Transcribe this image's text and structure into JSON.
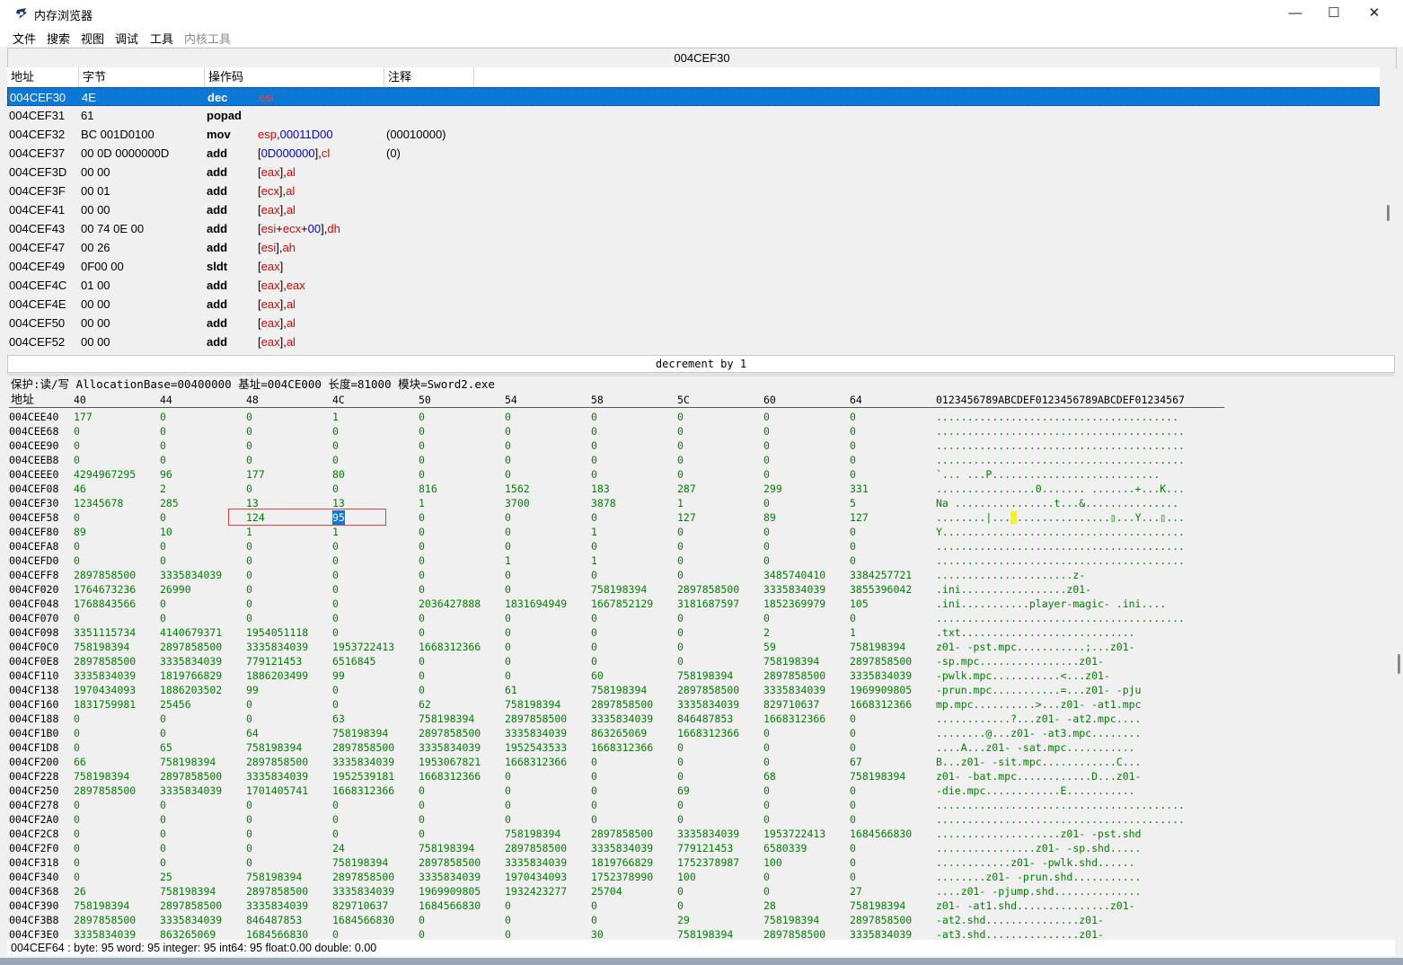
{
  "window": {
    "title": "内存浏览器",
    "minimize": "—",
    "maximize": "☐",
    "close": "✕"
  },
  "menu": [
    {
      "label": "文件",
      "enabled": true
    },
    {
      "label": "搜索",
      "enabled": true
    },
    {
      "label": "视图",
      "enabled": true
    },
    {
      "label": "调试",
      "enabled": true
    },
    {
      "label": "工具",
      "enabled": true
    },
    {
      "label": "内核工具",
      "enabled": false
    }
  ],
  "address_bar": "004CEF30",
  "disasm": {
    "columns": [
      "地址",
      "字节",
      "操作码",
      "注释"
    ],
    "rows": [
      {
        "addr": "004CEF30",
        "bytes": "4E",
        "op": "dec",
        "args": [
          {
            "t": "esi",
            "c": "r"
          }
        ],
        "comment": "",
        "selected": true
      },
      {
        "addr": "004CEF31",
        "bytes": "61",
        "op": "popad",
        "args": [],
        "comment": ""
      },
      {
        "addr": "004CEF32",
        "bytes": "BC 001D0100",
        "op": "mov",
        "args": [
          {
            "t": "esp",
            "c": "r"
          },
          {
            "t": ",",
            "c": "k"
          },
          {
            "t": "00011D00",
            "c": "b"
          }
        ],
        "comment": "(00010000)"
      },
      {
        "addr": "004CEF37",
        "bytes": "00 0D 0000000D",
        "op": "add",
        "args": [
          {
            "t": "[",
            "c": "k"
          },
          {
            "t": "0D000000",
            "c": "b"
          },
          {
            "t": "],",
            "c": "k"
          },
          {
            "t": "cl",
            "c": "r"
          }
        ],
        "comment": "(0)"
      },
      {
        "addr": "004CEF3D",
        "bytes": "00 00",
        "op": "add",
        "args": [
          {
            "t": "[",
            "c": "k"
          },
          {
            "t": "eax",
            "c": "r"
          },
          {
            "t": "],",
            "c": "k"
          },
          {
            "t": "al",
            "c": "r"
          }
        ],
        "comment": ""
      },
      {
        "addr": "004CEF3F",
        "bytes": "00 01",
        "op": "add",
        "args": [
          {
            "t": "[",
            "c": "k"
          },
          {
            "t": "ecx",
            "c": "r"
          },
          {
            "t": "],",
            "c": "k"
          },
          {
            "t": "al",
            "c": "r"
          }
        ],
        "comment": ""
      },
      {
        "addr": "004CEF41",
        "bytes": "00 00",
        "op": "add",
        "args": [
          {
            "t": "[",
            "c": "k"
          },
          {
            "t": "eax",
            "c": "r"
          },
          {
            "t": "],",
            "c": "k"
          },
          {
            "t": "al",
            "c": "r"
          }
        ],
        "comment": ""
      },
      {
        "addr": "004CEF43",
        "bytes": "00 74 0E 00",
        "op": "add",
        "args": [
          {
            "t": "[",
            "c": "k"
          },
          {
            "t": "esi",
            "c": "r"
          },
          {
            "t": "+",
            "c": "k"
          },
          {
            "t": "ecx",
            "c": "r"
          },
          {
            "t": "+",
            "c": "k"
          },
          {
            "t": "00",
            "c": "b"
          },
          {
            "t": "],",
            "c": "k"
          },
          {
            "t": "dh",
            "c": "r"
          }
        ],
        "comment": ""
      },
      {
        "addr": "004CEF47",
        "bytes": "00 26",
        "op": "add",
        "args": [
          {
            "t": "[",
            "c": "k"
          },
          {
            "t": "esi",
            "c": "r"
          },
          {
            "t": "],",
            "c": "k"
          },
          {
            "t": "ah",
            "c": "r"
          }
        ],
        "comment": ""
      },
      {
        "addr": "004CEF49",
        "bytes": "0F00 00",
        "op": "sldt",
        "args": [
          {
            "t": "[",
            "c": "k"
          },
          {
            "t": "eax",
            "c": "r"
          },
          {
            "t": "]",
            "c": "k"
          }
        ],
        "comment": ""
      },
      {
        "addr": "004CEF4C",
        "bytes": "01 00",
        "op": "add",
        "args": [
          {
            "t": "[",
            "c": "k"
          },
          {
            "t": "eax",
            "c": "r"
          },
          {
            "t": "],",
            "c": "k"
          },
          {
            "t": "eax",
            "c": "r"
          }
        ],
        "comment": ""
      },
      {
        "addr": "004CEF4E",
        "bytes": "00 00",
        "op": "add",
        "args": [
          {
            "t": "[",
            "c": "k"
          },
          {
            "t": "eax",
            "c": "r"
          },
          {
            "t": "],",
            "c": "k"
          },
          {
            "t": "al",
            "c": "r"
          }
        ],
        "comment": ""
      },
      {
        "addr": "004CEF50",
        "bytes": "00 00",
        "op": "add",
        "args": [
          {
            "t": "[",
            "c": "k"
          },
          {
            "t": "eax",
            "c": "r"
          },
          {
            "t": "],",
            "c": "k"
          },
          {
            "t": "al",
            "c": "r"
          }
        ],
        "comment": ""
      },
      {
        "addr": "004CEF52",
        "bytes": "00 00",
        "op": "add",
        "args": [
          {
            "t": "[",
            "c": "k"
          },
          {
            "t": "eax",
            "c": "r"
          },
          {
            "t": "],",
            "c": "k"
          },
          {
            "t": "al",
            "c": "r"
          }
        ],
        "comment": ""
      }
    ]
  },
  "instruction_description": "decrement by 1",
  "hex_view": {
    "protection_line": "保护:读/写  AllocationBase=00400000 基址=004CE000 长度=81000 模块=Sword2.exe",
    "address_header": "地址",
    "column_headers": [
      "40",
      "44",
      "48",
      "4C",
      "50",
      "54",
      "58",
      "5C",
      "60",
      "64"
    ],
    "ascii_header": "0123456789ABCDEF0123456789ABCDEF01234567",
    "rows": [
      {
        "addr": "004CEE40",
        "vals": [
          "177",
          "0",
          "0",
          "1",
          "0",
          "0",
          "0",
          "0",
          "0",
          "0"
        ],
        "ascii": " ......................................."
      },
      {
        "addr": "004CEE68",
        "vals": [
          "0",
          "0",
          "0",
          "0",
          "0",
          "0",
          "0",
          "0",
          "0",
          "0"
        ],
        "ascii": "........................................"
      },
      {
        "addr": "004CEE90",
        "vals": [
          "0",
          "0",
          "0",
          "0",
          "0",
          "0",
          "0",
          "0",
          "0",
          "0"
        ],
        "ascii": "........................................"
      },
      {
        "addr": "004CEEB8",
        "vals": [
          "0",
          "0",
          "0",
          "0",
          "0",
          "0",
          "0",
          "0",
          "0",
          "0"
        ],
        "ascii": "........................................"
      },
      {
        "addr": "004CEEE0",
        "vals": [
          "4294967295",
          "96",
          "177",
          "80",
          "0",
          "0",
          "0",
          "0",
          "0",
          "0"
        ],
        "ascii": "    `... ...P..........................."
      },
      {
        "addr": "004CEF08",
        "vals": [
          "46",
          "2",
          "0",
          "0",
          "816",
          "1562",
          "183",
          "287",
          "299",
          "331"
        ],
        "ascii": "................0....... .......+...K..."
      },
      {
        "addr": "004CEF30",
        "vals": [
          "12345678",
          "285",
          "13",
          "13",
          "1",
          "3700",
          "3878",
          "1",
          "0",
          "5"
        ],
        "ascii": "Na ................t...&..............."
      },
      {
        "addr": "004CEF58",
        "vals": [
          "0",
          "0",
          "124",
          "95",
          "0",
          "0",
          "0",
          "127",
          "89",
          "127"
        ],
        "ascii": "........|...█...............▯...Y...▯..."
      },
      {
        "addr": "004CEF80",
        "vals": [
          "89",
          "10",
          "1",
          "1",
          "0",
          "0",
          "1",
          "0",
          "0",
          "0"
        ],
        "ascii": "Y......................................."
      },
      {
        "addr": "004CEFA8",
        "vals": [
          "0",
          "0",
          "0",
          "0",
          "0",
          "0",
          "0",
          "0",
          "0",
          "0"
        ],
        "ascii": "........................................"
      },
      {
        "addr": "004CEFD0",
        "vals": [
          "0",
          "0",
          "0",
          "0",
          "0",
          "1",
          "1",
          "0",
          "0",
          "0"
        ],
        "ascii": "........................................"
      },
      {
        "addr": "004CEFF8",
        "vals": [
          "2897858500",
          "3335834039",
          "0",
          "0",
          "0",
          "0",
          "0",
          "0",
          "3485740410",
          "3384257721"
        ],
        "ascii": "        ......................z-"
      },
      {
        "addr": "004CF020",
        "vals": [
          "1764673236",
          "26990",
          "0",
          "0",
          "0",
          "0",
          "758198394",
          "2897858500",
          "3335834039",
          "3855396042"
        ],
        "ascii": "  .ini.................z01-"
      },
      {
        "addr": "004CF048",
        "vals": [
          "1768843566",
          "0",
          "0",
          "0",
          "2036427888",
          "1831694949",
          "1667852129",
          "3181687597",
          "1852369979",
          "105"
        ],
        "ascii": ".ini...........player-magic-    .ini...."
      },
      {
        "addr": "004CF070",
        "vals": [
          "0",
          "0",
          "0",
          "0",
          "0",
          "0",
          "0",
          "0",
          "0",
          "0"
        ],
        "ascii": "........................................"
      },
      {
        "addr": "004CF098",
        "vals": [
          "3351115734",
          "4140679371",
          "1954051118",
          "0",
          "0",
          "0",
          "0",
          "0",
          "2",
          "1"
        ],
        "ascii": "        .txt............................"
      },
      {
        "addr": "004CF0C0",
        "vals": [
          "758198394",
          "2897858500",
          "3335834039",
          "1953722413",
          "1668312366",
          "0",
          "0",
          "0",
          "59",
          "758198394"
        ],
        "ascii": "z01-        -pst.mpc...........;...z01-"
      },
      {
        "addr": "004CF0E8",
        "vals": [
          "2897858500",
          "3335834039",
          "779121453",
          "6516845",
          "0",
          "0",
          "0",
          "0",
          "758198394",
          "2897858500"
        ],
        "ascii": "        -sp.mpc................z01-"
      },
      {
        "addr": "004CF110",
        "vals": [
          "3335834039",
          "1819766829",
          "1886203499",
          "99",
          "0",
          "0",
          "60",
          "758198394",
          "2897858500",
          "3335834039"
        ],
        "ascii": "    -pwlk.mpc...........<...z01-"
      },
      {
        "addr": "004CF138",
        "vals": [
          "1970434093",
          "1886203502",
          "99",
          "0",
          "0",
          "61",
          "758198394",
          "2897858500",
          "3335834039",
          "1969909805"
        ],
        "ascii": "-prun.mpc...........=...z01-        -pju"
      },
      {
        "addr": "004CF160",
        "vals": [
          "1831759981",
          "25456",
          "0",
          "0",
          "62",
          "758198394",
          "2897858500",
          "3335834039",
          "829710637",
          "1668312366"
        ],
        "ascii": "mp.mpc..........>...z01-        -at1.mpc"
      },
      {
        "addr": "004CF188",
        "vals": [
          "0",
          "0",
          "0",
          "63",
          "758198394",
          "2897858500",
          "3335834039",
          "846487853",
          "1668312366",
          "0"
        ],
        "ascii": "............?...z01-        -at2.mpc...."
      },
      {
        "addr": "004CF1B0",
        "vals": [
          "0",
          "0",
          "64",
          "758198394",
          "2897858500",
          "3335834039",
          "863265069",
          "1668312366",
          "0",
          "0"
        ],
        "ascii": "........@...z01-        -at3.mpc........"
      },
      {
        "addr": "004CF1D8",
        "vals": [
          "0",
          "65",
          "758198394",
          "2897858500",
          "3335834039",
          "1952543533",
          "1668312366",
          "0",
          "0",
          "0"
        ],
        "ascii": "....A...z01-        -sat.mpc..........."
      },
      {
        "addr": "004CF200",
        "vals": [
          "66",
          "758198394",
          "2897858500",
          "3335834039",
          "1953067821",
          "1668312366",
          "0",
          "0",
          "0",
          "67"
        ],
        "ascii": "B...z01-        -sit.mpc............C..."
      },
      {
        "addr": "004CF228",
        "vals": [
          "758198394",
          "2897858500",
          "3335834039",
          "1952539181",
          "1668312366",
          "0",
          "0",
          "0",
          "68",
          "758198394"
        ],
        "ascii": "z01-        -bat.mpc............D...z01-"
      },
      {
        "addr": "004CF250",
        "vals": [
          "2897858500",
          "3335834039",
          "1701405741",
          "1668312366",
          "0",
          "0",
          "0",
          "69",
          "0",
          "0"
        ],
        "ascii": "        -die.mpc............E..........."
      },
      {
        "addr": "004CF278",
        "vals": [
          "0",
          "0",
          "0",
          "0",
          "0",
          "0",
          "0",
          "0",
          "0",
          "0"
        ],
        "ascii": "........................................"
      },
      {
        "addr": "004CF2A0",
        "vals": [
          "0",
          "0",
          "0",
          "0",
          "0",
          "0",
          "0",
          "0",
          "0",
          "0"
        ],
        "ascii": "........................................"
      },
      {
        "addr": "004CF2C8",
        "vals": [
          "0",
          "0",
          "0",
          "0",
          "0",
          "758198394",
          "2897858500",
          "3335834039",
          "1953722413",
          "1684566830"
        ],
        "ascii": "....................z01-        -pst.shd"
      },
      {
        "addr": "004CF2F0",
        "vals": [
          "0",
          "0",
          "0",
          "24",
          "758198394",
          "2897858500",
          "3335834039",
          "779121453",
          "6580339",
          "0"
        ],
        "ascii": "................z01-        -sp.shd....."
      },
      {
        "addr": "004CF318",
        "vals": [
          "0",
          "0",
          "0",
          "758198394",
          "2897858500",
          "3335834039",
          "1819766829",
          "1752378987",
          "100",
          "0"
        ],
        "ascii": "............z01-        -pwlk.shd......"
      },
      {
        "addr": "004CF340",
        "vals": [
          "0",
          "25",
          "758198394",
          "2897858500",
          "3335834039",
          "1970434093",
          "1752378990",
          "100",
          "0",
          "0"
        ],
        "ascii": "........z01-        -prun.shd..........."
      },
      {
        "addr": "004CF368",
        "vals": [
          "26",
          "758198394",
          "2897858500",
          "3335834039",
          "1969909805",
          "1932423277",
          "25704",
          "0",
          "0",
          "27"
        ],
        "ascii": "....z01-        -pjump.shd.............."
      },
      {
        "addr": "004CF390",
        "vals": [
          "758198394",
          "2897858500",
          "3335834039",
          "829710637",
          "1684566830",
          "0",
          "0",
          "0",
          "28",
          "758198394"
        ],
        "ascii": "z01-        -at1.shd...............z01-"
      },
      {
        "addr": "004CF3B8",
        "vals": [
          "2897858500",
          "3335834039",
          "846487853",
          "1684566830",
          "0",
          "0",
          "0",
          "29",
          "758198394",
          "2897858500"
        ],
        "ascii": "        -at2.shd...............z01-"
      },
      {
        "addr": "004CF3E0",
        "vals": [
          "3335834039",
          "863265069",
          "1684566830",
          "0",
          "0",
          "0",
          "30",
          "758198394",
          "2897858500",
          "3335834039"
        ],
        "ascii": "    -at3.shd...............z01-"
      }
    ]
  },
  "status": "004CEF64 : byte: 95 word: 95 integer: 95 int64: 95 float:0.00 double: 0.00",
  "colors": {
    "selection": "#0c78d6",
    "register": "#e30000",
    "immediate": "#0000ee",
    "hex_value": "#008000",
    "highlight_box": "#e34040"
  }
}
